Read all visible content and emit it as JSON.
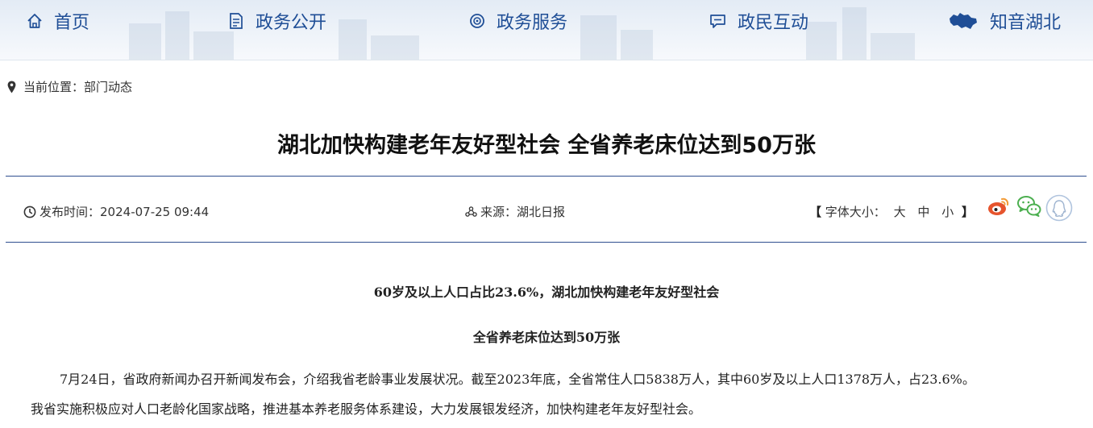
{
  "nav": {
    "items": [
      {
        "label": "首页",
        "icon": "home-icon"
      },
      {
        "label": "政务公开",
        "icon": "document-icon"
      },
      {
        "label": "政务服务",
        "icon": "service-icon"
      },
      {
        "label": "政民互动",
        "icon": "chat-icon"
      },
      {
        "label": "知音湖北",
        "icon": "hubei-map-icon"
      }
    ]
  },
  "breadcrumb": {
    "prefix": "当前位置：",
    "current": "部门动态"
  },
  "article": {
    "title": "湖北加快构建老年友好型社会 全省养老床位达到50万张",
    "meta": {
      "publish_label": "发布时间：",
      "publish_time": "2024-07-25 09:44",
      "source_label": "来源：",
      "source": "湖北日报",
      "font_size_label": "字体大小：",
      "sizes": [
        "大",
        "中",
        "小"
      ]
    },
    "share": [
      "weibo-icon",
      "wechat-icon",
      "qq-icon"
    ],
    "subheadings": [
      "60岁及以上人口占比23.6%，湖北加快构建老年友好型社会",
      "全省养老床位达到50万张"
    ],
    "paragraph_lines": [
      "7月24日，省政府新闻办召开新闻发布会，介绍我省老龄事业发展状况。截至2023年底，全省常住人口5838万人，其中60岁及以上人口1378万人，占23.6%。",
      "我省实施积极应对人口老龄化国家战略，推进基本养老服务体系建设，大力发展银发经济，加快构建老年友好型社会。"
    ]
  },
  "colors": {
    "nav_text": "#1f4e96",
    "rule": "#2f4f8f",
    "weibo": "#e6542d",
    "wechat": "#4caf50"
  }
}
